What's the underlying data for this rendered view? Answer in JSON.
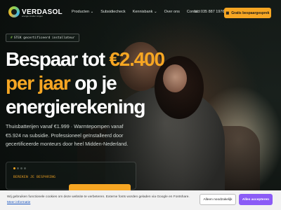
{
  "brand": {
    "name": "VERDASOL",
    "tagline": "energie zonder zorgen",
    "accent": "#f6a623",
    "green": "#8fd14f"
  },
  "nav": {
    "items": [
      {
        "label": "Producten",
        "has_dropdown": true
      },
      {
        "label": "Subsidiecheck",
        "has_dropdown": false
      },
      {
        "label": "Kennisbank",
        "has_dropdown": true
      },
      {
        "label": "Over ons",
        "has_dropdown": false
      },
      {
        "label": "Contact",
        "has_dropdown": false
      }
    ],
    "phone": "035 887 1976",
    "cta": "Gratis bespaargesprek"
  },
  "hero": {
    "badge_prefix": "#",
    "badge_text": "STEK gecertificeerd installateur",
    "headline_part1": "Bespaar tot ",
    "headline_highlight1": "€2.400",
    "headline_highlight2": "per jaar",
    "headline_part2": " op je",
    "headline_line3": "energierekening",
    "subtitle": "Thuisbatterijen vanaf €1.999 · Warmtepompen vanaf €5.924 na subsidie. Professioneel geïnstalleerd door gecertificeerde monteurs door heel Midden-Nederland."
  },
  "calculator": {
    "label": "BEREKEN JE BESPARING",
    "steps_total": 4,
    "steps_active": 1
  },
  "cookie": {
    "text": "Wij gebruiken functionele cookies om deze website te verbeteren. Externe fonts worden geladen via Google en Fontshare.",
    "link": "Meer informatie",
    "btn_necessary": "Alleen noodzakelijk",
    "btn_accept": "Alles accepteren"
  }
}
